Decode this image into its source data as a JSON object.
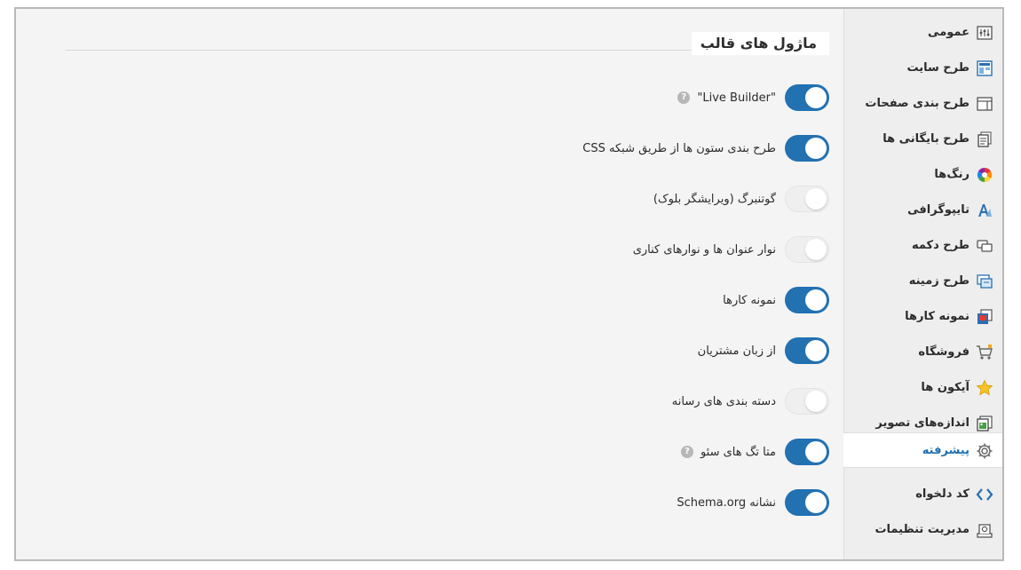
{
  "colors": {
    "toggle_on": "#2271b1",
    "toggle_off": "#efefef",
    "active_text": "#1d6fb0",
    "sidebar_bg": "#eeeeee",
    "content_bg": "#f4f4f4"
  },
  "sidebar": {
    "items": [
      {
        "label": "عمومی",
        "icon": "general-icon",
        "active": false
      },
      {
        "label": "طرح سایت",
        "icon": "site-layout-icon",
        "active": false
      },
      {
        "label": "طرح بندی صفحات",
        "icon": "page-layout-icon",
        "active": false
      },
      {
        "label": "طرح بایگانی ها",
        "icon": "archive-icon",
        "active": false
      },
      {
        "label": "رنگ‌ها",
        "icon": "color-wheel-icon",
        "active": false
      },
      {
        "label": "تایپوگرافی",
        "icon": "typography-icon",
        "active": false
      },
      {
        "label": "طرح دکمه",
        "icon": "button-icon",
        "active": false
      },
      {
        "label": "طرح زمینه",
        "icon": "background-icon",
        "active": false
      },
      {
        "label": "نمونه کارها",
        "icon": "portfolio-icon",
        "active": false
      },
      {
        "label": "فروشگاه",
        "icon": "cart-icon",
        "active": false
      },
      {
        "label": "آیکون ها",
        "icon": "star-icon",
        "active": false
      },
      {
        "label": "اندازه‌های تصویر",
        "icon": "image-sizes-icon",
        "active": false
      },
      {
        "label": "پیشرفته",
        "icon": "gear-icon",
        "active": true
      },
      {
        "label": "کد دلخواه",
        "icon": "code-icon",
        "active": false
      },
      {
        "label": "مدیریت تنظیمات",
        "icon": "settings-manager-icon",
        "active": false
      }
    ]
  },
  "main": {
    "section_title": "ماژول های قالب",
    "modules": [
      {
        "label": "\"Live Builder\"",
        "enabled": true,
        "help": true
      },
      {
        "label": "طرح بندی ستون ها از طریق شبکه CSS",
        "enabled": true,
        "help": false
      },
      {
        "label": "گوتنبرگ (ویرایشگر بلوک)",
        "enabled": false,
        "help": false
      },
      {
        "label": "نوار عنوان ها و نوارهای کناری",
        "enabled": false,
        "help": false
      },
      {
        "label": "نمونه کارها",
        "enabled": true,
        "help": false
      },
      {
        "label": "از زبان مشتریان",
        "enabled": true,
        "help": false
      },
      {
        "label": "دسته بندی های رسانه",
        "enabled": false,
        "help": false
      },
      {
        "label": "متا تگ های سئو",
        "enabled": true,
        "help": true
      },
      {
        "label": "نشانه Schema.org",
        "enabled": true,
        "help": false
      }
    ],
    "help_glyph": "?"
  }
}
